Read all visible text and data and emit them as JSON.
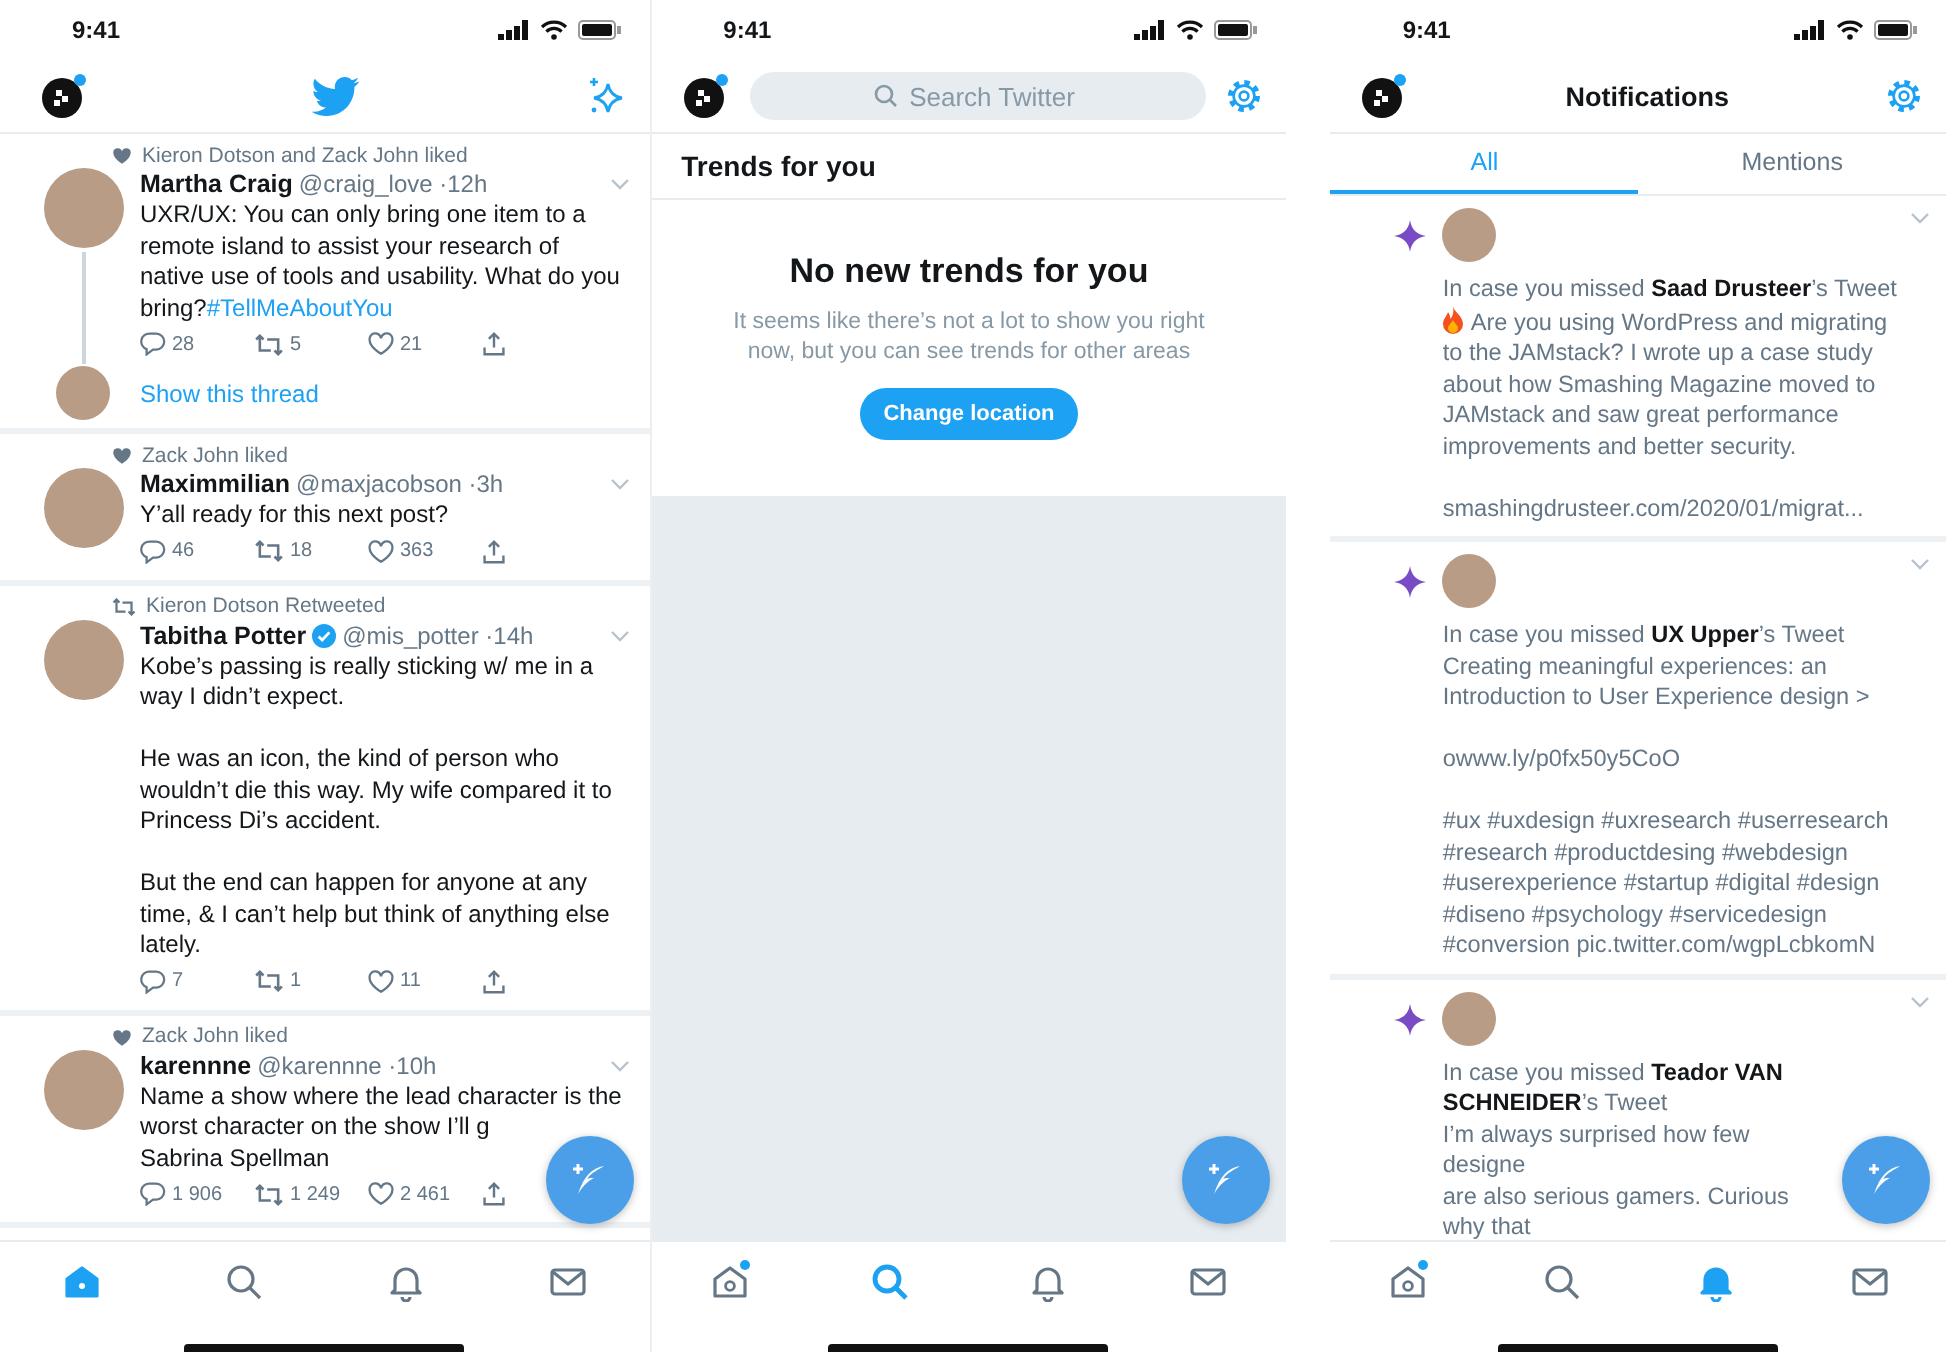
{
  "home_screen": {
    "status_bar": {
      "time": "9:41"
    },
    "tweets": [
      {
        "context": {
          "kind": "like",
          "text": "Kieron Dotson and Zack John liked"
        },
        "name": "Martha Craig",
        "verified": false,
        "handle": "@craig_love",
        "time": "·12h",
        "text": "UXR/UX: You can only bring one item to a remote island to assist your research of native use of tools and usability. What do you bring?",
        "hashtag": "#TellMeAboutYou",
        "replies": "28",
        "retweets": "5",
        "likes": "21",
        "thread_link": "Show this thread"
      },
      {
        "context": {
          "kind": "like",
          "text": "Zack John liked"
        },
        "name": "Maximmilian",
        "verified": false,
        "handle": "@maxjacobson",
        "time": "·3h",
        "text": "Y’all ready for this next post?",
        "replies": "46",
        "retweets": "18",
        "likes": "363"
      },
      {
        "context": {
          "kind": "retweet",
          "text": "Kieron Dotson Retweeted"
        },
        "name": "Tabitha Potter",
        "verified": true,
        "handle": "@mis_potter",
        "time": "·14h",
        "text": "Kobe’s passing is really sticking w/ me in a way I didn’t expect.\n\nHe was an icon, the kind of person who wouldn’t die this way. My wife compared it to Princess Di’s accident.\n\nBut the end can happen for anyone at any time, & I can’t help but think of anything else lately.",
        "replies": "7",
        "retweets": "1",
        "likes": "11"
      },
      {
        "context": {
          "kind": "like",
          "text": "Zack John liked"
        },
        "name": "karennne",
        "verified": false,
        "handle": "@karennne",
        "time": "·10h",
        "text": "Name a show where the lead character is the worst character on the show I’ll g\nSabrina Spellman",
        "replies": "1 906",
        "retweets": "1 249",
        "likes": "2 461"
      }
    ],
    "tab_bar": [
      {
        "kind": "home",
        "selected": true,
        "dot": false
      },
      {
        "kind": "search",
        "selected": false,
        "dot": false
      },
      {
        "kind": "notifications",
        "selected": false,
        "dot": false
      },
      {
        "kind": "messages",
        "selected": false,
        "dot": false
      }
    ]
  },
  "explore_screen": {
    "status_bar": {
      "time": "9:41"
    },
    "search": {
      "placeholder": "Search Twitter"
    },
    "section_title": "Trends for you",
    "empty_title": "No new trends for you",
    "empty_text": "It seems like there’s not a lot to show you right now, but you can see trends for other areas",
    "button": "Change location",
    "tab_bar": [
      {
        "kind": "home",
        "selected": false,
        "dot": true
      },
      {
        "kind": "search",
        "selected": true,
        "dot": false
      },
      {
        "kind": "notifications",
        "selected": false,
        "dot": false
      },
      {
        "kind": "messages",
        "selected": false,
        "dot": false
      }
    ]
  },
  "notifications_screen": {
    "status_bar": {
      "time": "9:41"
    },
    "title": "Notifications",
    "tabs": [
      {
        "label": "All",
        "selected": true
      },
      {
        "label": "Mentions",
        "selected": false
      }
    ],
    "items": [
      {
        "intro": "In case you missed **Saad Drusteer**’s Tweet",
        "emoji": true,
        "text": "Are you using WordPress and migrating to the JAMstack? I wrote up a case study about how Smashing Magazine moved to JAMstack and saw great performance improvements and better security.\n\nsmashingdrusteer.com/2020/01/migrat..."
      },
      {
        "intro": "In case you missed **UX Upper**’s Tweet",
        "emoji": false,
        "text": "Creating meaningful experiences: an Introduction to User Experience design >\n\nowww.ly/p0fx50y5CoO\n\n#ux #uxdesign #uxresearch #userresearch #research #productdesing #webdesign #userexperience #startup #digital #design #diseno #psychology #servicedesign #conversion pic.twitter.com/wgpLcbkomN"
      },
      {
        "intro": "In case you missed **Teador VAN SCHNEIDER**’s Tweet",
        "emoji": false,
        "text": "I’m always surprised how few designe\nare also serious gamers. Curious why that"
      }
    ],
    "tab_bar": [
      {
        "kind": "home",
        "selected": false,
        "dot": true
      },
      {
        "kind": "search",
        "selected": false,
        "dot": false
      },
      {
        "kind": "notifications",
        "selected": true,
        "dot": false
      },
      {
        "kind": "messages",
        "selected": false,
        "dot": false
      }
    ]
  }
}
